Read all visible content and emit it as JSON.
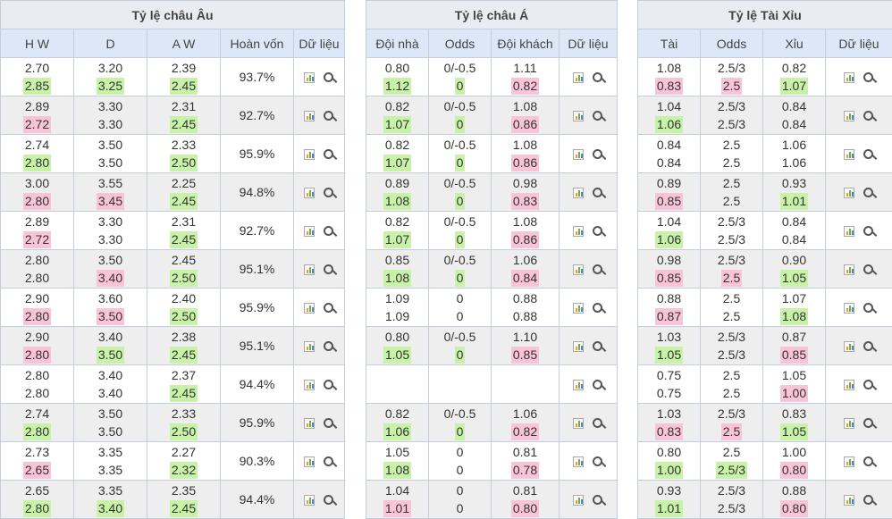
{
  "eu": {
    "title": "Tỷ lệ châu Âu",
    "headers": [
      "H W",
      "D",
      "A W",
      "Hoàn vốn",
      "Dữ liệu"
    ],
    "rows": [
      {
        "hw": [
          "2.70",
          "2.85"
        ],
        "hw_s": [
          "",
          "up"
        ],
        "d": [
          "3.20",
          "3.25"
        ],
        "d_s": [
          "",
          "up"
        ],
        "aw": [
          "2.39",
          "2.45"
        ],
        "aw_s": [
          "",
          "up"
        ],
        "ret": "93.7%"
      },
      {
        "hw": [
          "2.89",
          "2.72"
        ],
        "hw_s": [
          "",
          "down"
        ],
        "d": [
          "3.30",
          "3.30"
        ],
        "d_s": [
          "",
          ""
        ],
        "aw": [
          "2.31",
          "2.45"
        ],
        "aw_s": [
          "",
          "up"
        ],
        "ret": "92.7%"
      },
      {
        "hw": [
          "2.74",
          "2.80"
        ],
        "hw_s": [
          "",
          "up"
        ],
        "d": [
          "3.50",
          "3.50"
        ],
        "d_s": [
          "",
          ""
        ],
        "aw": [
          "2.33",
          "2.50"
        ],
        "aw_s": [
          "",
          "up"
        ],
        "ret": "95.9%"
      },
      {
        "hw": [
          "3.00",
          "2.80"
        ],
        "hw_s": [
          "",
          "down"
        ],
        "d": [
          "3.55",
          "3.45"
        ],
        "d_s": [
          "",
          "down"
        ],
        "aw": [
          "2.25",
          "2.45"
        ],
        "aw_s": [
          "",
          "up"
        ],
        "ret": "94.8%"
      },
      {
        "hw": [
          "2.89",
          "2.72"
        ],
        "hw_s": [
          "",
          "down"
        ],
        "d": [
          "3.30",
          "3.30"
        ],
        "d_s": [
          "",
          ""
        ],
        "aw": [
          "2.31",
          "2.45"
        ],
        "aw_s": [
          "",
          "up"
        ],
        "ret": "92.7%"
      },
      {
        "hw": [
          "2.80",
          "2.80"
        ],
        "hw_s": [
          "",
          ""
        ],
        "d": [
          "3.50",
          "3.40"
        ],
        "d_s": [
          "",
          "down"
        ],
        "aw": [
          "2.45",
          "2.50"
        ],
        "aw_s": [
          "",
          "up"
        ],
        "ret": "95.1%"
      },
      {
        "hw": [
          "2.90",
          "2.80"
        ],
        "hw_s": [
          "",
          "down"
        ],
        "d": [
          "3.60",
          "3.50"
        ],
        "d_s": [
          "",
          "down"
        ],
        "aw": [
          "2.40",
          "2.50"
        ],
        "aw_s": [
          "",
          "up"
        ],
        "ret": "95.9%"
      },
      {
        "hw": [
          "2.90",
          "2.80"
        ],
        "hw_s": [
          "",
          "down"
        ],
        "d": [
          "3.40",
          "3.50"
        ],
        "d_s": [
          "",
          "up"
        ],
        "aw": [
          "2.38",
          "2.45"
        ],
        "aw_s": [
          "",
          "up"
        ],
        "ret": "95.1%"
      },
      {
        "hw": [
          "2.80",
          "2.80"
        ],
        "hw_s": [
          "",
          ""
        ],
        "d": [
          "3.40",
          "3.40"
        ],
        "d_s": [
          "",
          ""
        ],
        "aw": [
          "2.37",
          "2.45"
        ],
        "aw_s": [
          "",
          "up"
        ],
        "ret": "94.4%"
      },
      {
        "hw": [
          "2.74",
          "2.80"
        ],
        "hw_s": [
          "",
          "up"
        ],
        "d": [
          "3.50",
          "3.50"
        ],
        "d_s": [
          "",
          ""
        ],
        "aw": [
          "2.33",
          "2.50"
        ],
        "aw_s": [
          "",
          "up"
        ],
        "ret": "95.9%"
      },
      {
        "hw": [
          "2.73",
          "2.65"
        ],
        "hw_s": [
          "",
          "down"
        ],
        "d": [
          "3.35",
          "3.35"
        ],
        "d_s": [
          "",
          ""
        ],
        "aw": [
          "2.27",
          "2.32"
        ],
        "aw_s": [
          "",
          "up"
        ],
        "ret": "90.3%"
      },
      {
        "hw": [
          "2.65",
          "2.80"
        ],
        "hw_s": [
          "",
          "up"
        ],
        "d": [
          "3.35",
          "3.40"
        ],
        "d_s": [
          "",
          "up"
        ],
        "aw": [
          "2.35",
          "2.45"
        ],
        "aw_s": [
          "",
          "up"
        ],
        "ret": "94.4%"
      }
    ]
  },
  "asia": {
    "title": "Tỷ lệ châu Á",
    "headers": [
      "Đội nhà",
      "Odds",
      "Đội khách",
      "Dữ liệu"
    ],
    "rows": [
      {
        "h": [
          "0.80",
          "1.12"
        ],
        "h_s": [
          "",
          "up"
        ],
        "o": [
          "0/-0.5",
          "0"
        ],
        "o_s": [
          "",
          "up"
        ],
        "a": [
          "1.11",
          "0.82"
        ],
        "a_s": [
          "",
          "down"
        ]
      },
      {
        "h": [
          "0.82",
          "1.07"
        ],
        "h_s": [
          "",
          "up"
        ],
        "o": [
          "0/-0.5",
          "0"
        ],
        "o_s": [
          "",
          "up"
        ],
        "a": [
          "1.08",
          "0.86"
        ],
        "a_s": [
          "",
          "down"
        ]
      },
      {
        "h": [
          "0.82",
          "1.07"
        ],
        "h_s": [
          "",
          "up"
        ],
        "o": [
          "0/-0.5",
          "0"
        ],
        "o_s": [
          "",
          "up"
        ],
        "a": [
          "1.08",
          "0.86"
        ],
        "a_s": [
          "",
          "down"
        ]
      },
      {
        "h": [
          "0.89",
          "1.08"
        ],
        "h_s": [
          "",
          "up"
        ],
        "o": [
          "0/-0.5",
          "0"
        ],
        "o_s": [
          "",
          "up"
        ],
        "a": [
          "0.98",
          "0.83"
        ],
        "a_s": [
          "",
          "down"
        ]
      },
      {
        "h": [
          "0.82",
          "1.07"
        ],
        "h_s": [
          "",
          "up"
        ],
        "o": [
          "0/-0.5",
          "0"
        ],
        "o_s": [
          "",
          "up"
        ],
        "a": [
          "1.08",
          "0.86"
        ],
        "a_s": [
          "",
          "down"
        ]
      },
      {
        "h": [
          "0.85",
          "1.08"
        ],
        "h_s": [
          "",
          "up"
        ],
        "o": [
          "0/-0.5",
          "0"
        ],
        "o_s": [
          "",
          "up"
        ],
        "a": [
          "1.06",
          "0.84"
        ],
        "a_s": [
          "",
          "down"
        ]
      },
      {
        "h": [
          "1.09",
          "1.09"
        ],
        "h_s": [
          "",
          ""
        ],
        "o": [
          "0",
          "0"
        ],
        "o_s": [
          "",
          ""
        ],
        "a": [
          "0.88",
          "0.88"
        ],
        "a_s": [
          "",
          ""
        ]
      },
      {
        "h": [
          "0.80",
          "1.05"
        ],
        "h_s": [
          "",
          "up"
        ],
        "o": [
          "0/-0.5",
          "0"
        ],
        "o_s": [
          "",
          "up"
        ],
        "a": [
          "1.10",
          "0.85"
        ],
        "a_s": [
          "",
          "down"
        ]
      },
      {
        "h": [
          "",
          ""
        ],
        "h_s": [
          "",
          ""
        ],
        "o": [
          "",
          ""
        ],
        "o_s": [
          "",
          ""
        ],
        "a": [
          "",
          ""
        ],
        "a_s": [
          "",
          ""
        ]
      },
      {
        "h": [
          "0.82",
          "1.06"
        ],
        "h_s": [
          "",
          "up"
        ],
        "o": [
          "0/-0.5",
          "0"
        ],
        "o_s": [
          "",
          "up"
        ],
        "a": [
          "1.06",
          "0.82"
        ],
        "a_s": [
          "",
          "down"
        ]
      },
      {
        "h": [
          "1.05",
          "1.08"
        ],
        "h_s": [
          "",
          "up"
        ],
        "o": [
          "0",
          "0"
        ],
        "o_s": [
          "",
          ""
        ],
        "a": [
          "0.81",
          "0.78"
        ],
        "a_s": [
          "",
          "down"
        ]
      },
      {
        "h": [
          "1.04",
          "1.01"
        ],
        "h_s": [
          "",
          "down"
        ],
        "o": [
          "0",
          "0"
        ],
        "o_s": [
          "",
          ""
        ],
        "a": [
          "0.81",
          "0.80"
        ],
        "a_s": [
          "",
          "down"
        ]
      }
    ]
  },
  "ou": {
    "title": "Tỷ lệ Tài Xỉu",
    "headers": [
      "Tài",
      "Odds",
      "Xỉu",
      "Dữ liệu"
    ],
    "rows": [
      {
        "t": [
          "1.08",
          "0.83"
        ],
        "t_s": [
          "",
          "down"
        ],
        "o": [
          "2.5/3",
          "2.5"
        ],
        "o_s": [
          "",
          "down"
        ],
        "x": [
          "0.82",
          "1.07"
        ],
        "x_s": [
          "",
          "up"
        ]
      },
      {
        "t": [
          "1.04",
          "1.06"
        ],
        "t_s": [
          "",
          "up"
        ],
        "o": [
          "2.5/3",
          "2.5/3"
        ],
        "o_s": [
          "",
          ""
        ],
        "x": [
          "0.84",
          "0.84"
        ],
        "x_s": [
          "",
          ""
        ]
      },
      {
        "t": [
          "0.84",
          "0.84"
        ],
        "t_s": [
          "",
          ""
        ],
        "o": [
          "2.5",
          "2.5"
        ],
        "o_s": [
          "",
          ""
        ],
        "x": [
          "1.06",
          "1.06"
        ],
        "x_s": [
          "",
          ""
        ]
      },
      {
        "t": [
          "0.89",
          "0.85"
        ],
        "t_s": [
          "",
          "down"
        ],
        "o": [
          "2.5",
          "2.5"
        ],
        "o_s": [
          "",
          ""
        ],
        "x": [
          "0.93",
          "1.01"
        ],
        "x_s": [
          "",
          "up"
        ]
      },
      {
        "t": [
          "1.04",
          "1.06"
        ],
        "t_s": [
          "",
          "up"
        ],
        "o": [
          "2.5/3",
          "2.5/3"
        ],
        "o_s": [
          "",
          ""
        ],
        "x": [
          "0.84",
          "0.84"
        ],
        "x_s": [
          "",
          ""
        ]
      },
      {
        "t": [
          "0.98",
          "0.85"
        ],
        "t_s": [
          "",
          "down"
        ],
        "o": [
          "2.5/3",
          "2.5"
        ],
        "o_s": [
          "",
          "down"
        ],
        "x": [
          "0.90",
          "1.05"
        ],
        "x_s": [
          "",
          "up"
        ]
      },
      {
        "t": [
          "0.88",
          "0.87"
        ],
        "t_s": [
          "",
          "down"
        ],
        "o": [
          "2.5",
          "2.5"
        ],
        "o_s": [
          "",
          ""
        ],
        "x": [
          "1.07",
          "1.08"
        ],
        "x_s": [
          "",
          "up"
        ]
      },
      {
        "t": [
          "1.03",
          "1.05"
        ],
        "t_s": [
          "",
          "up"
        ],
        "o": [
          "2.5/3",
          "2.5/3"
        ],
        "o_s": [
          "",
          ""
        ],
        "x": [
          "0.87",
          "0.85"
        ],
        "x_s": [
          "",
          "down"
        ]
      },
      {
        "t": [
          "0.75",
          "0.75"
        ],
        "t_s": [
          "",
          ""
        ],
        "o": [
          "2.5",
          "2.5"
        ],
        "o_s": [
          "",
          ""
        ],
        "x": [
          "1.05",
          "1.00"
        ],
        "x_s": [
          "",
          "down"
        ]
      },
      {
        "t": [
          "1.03",
          "0.83"
        ],
        "t_s": [
          "",
          "down"
        ],
        "o": [
          "2.5/3",
          "2.5"
        ],
        "o_s": [
          "",
          "down"
        ],
        "x": [
          "0.83",
          "1.05"
        ],
        "x_s": [
          "",
          "up"
        ]
      },
      {
        "t": [
          "0.80",
          "1.00"
        ],
        "t_s": [
          "",
          "up"
        ],
        "o": [
          "2.5",
          "2.5/3"
        ],
        "o_s": [
          "",
          "up"
        ],
        "x": [
          "1.00",
          "0.80"
        ],
        "x_s": [
          "",
          "down"
        ]
      },
      {
        "t": [
          "0.93",
          "1.01"
        ],
        "t_s": [
          "",
          "up"
        ],
        "o": [
          "2.5/3",
          "2.5/3"
        ],
        "o_s": [
          "",
          ""
        ],
        "x": [
          "0.88",
          "0.80"
        ],
        "x_s": [
          "",
          "down"
        ]
      }
    ]
  },
  "colors": {
    "up": "#c8f2a8",
    "down": "#f8c4d6",
    "header": "#dce7f7",
    "title_bg": "#e9edf3",
    "alt_row": "#eeeeee"
  },
  "icons": [
    "bar-chart-icon",
    "search-icon"
  ]
}
